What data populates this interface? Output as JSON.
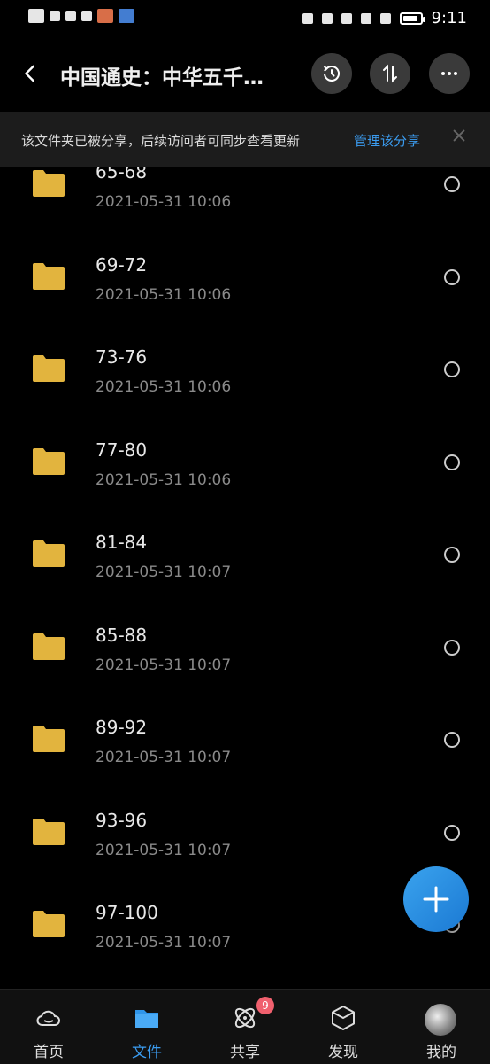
{
  "status_bar": {
    "time": "9:11"
  },
  "header": {
    "title": "中国通史：中华五千…"
  },
  "notice": {
    "message": "该文件夹已被分享，后续访问者可同步查看更新",
    "link": "管理该分享"
  },
  "items": [
    {
      "name": "65-68",
      "date": "2021-05-31  10:06"
    },
    {
      "name": "69-72",
      "date": "2021-05-31  10:06"
    },
    {
      "name": "73-76",
      "date": "2021-05-31  10:06"
    },
    {
      "name": "77-80",
      "date": "2021-05-31  10:06"
    },
    {
      "name": "81-84",
      "date": "2021-05-31  10:07"
    },
    {
      "name": "85-88",
      "date": "2021-05-31  10:07"
    },
    {
      "name": "89-92",
      "date": "2021-05-31  10:07"
    },
    {
      "name": "93-96",
      "date": "2021-05-31  10:07"
    },
    {
      "name": "97-100",
      "date": "2021-05-31  10:07"
    }
  ],
  "nav": {
    "tabs": [
      {
        "label": "首页",
        "icon": "cloud-icon"
      },
      {
        "label": "文件",
        "icon": "folder-icon"
      },
      {
        "label": "共享",
        "icon": "atom-icon",
        "badge": "9"
      },
      {
        "label": "发现",
        "icon": "cube-icon"
      },
      {
        "label": "我的",
        "icon": "avatar"
      }
    ]
  },
  "colors": {
    "accent": "#3b9cf0",
    "folder": "#e2b43e",
    "badge": "#f0606e"
  }
}
